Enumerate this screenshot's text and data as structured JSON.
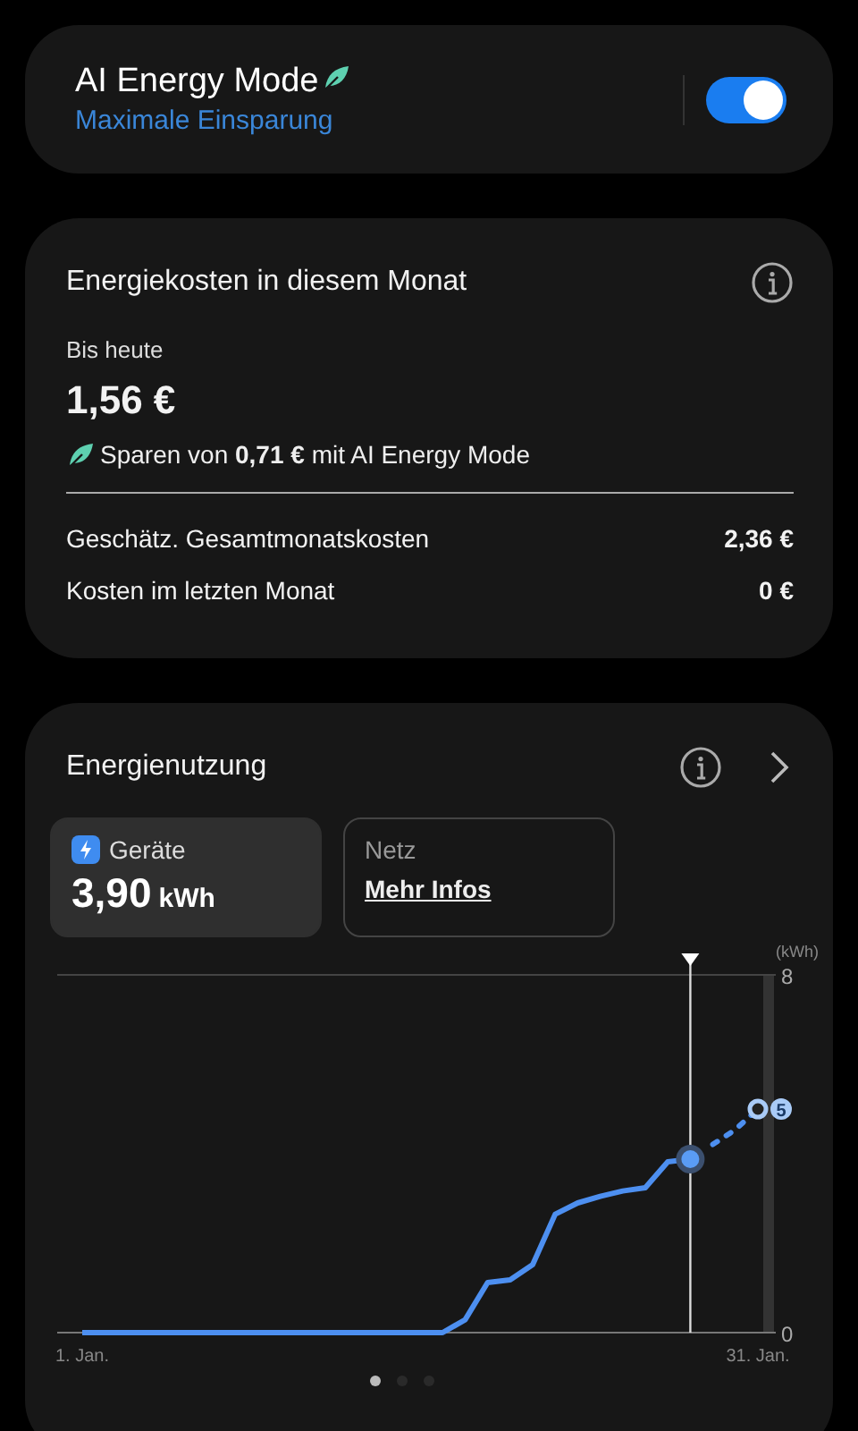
{
  "mode_card": {
    "title": "AI Energy Mode",
    "subtitle": "Maximale Einsparung",
    "on": true
  },
  "cost_card": {
    "title": "Energiekosten in diesem Monat",
    "to_date_label": "Bis heute",
    "to_date_value": "1,56 €",
    "savings": "Sparen von **0,71 €** mit AI Energy Mode",
    "rows": [
      {
        "label": "Geschätz. Gesamtmonatskosten",
        "value": "2,36 €"
      },
      {
        "label": "Kosten im letzten Monat",
        "value": "0 €"
      }
    ]
  },
  "usage_card": {
    "title": "Energienutzung",
    "tiles": [
      {
        "kind": "value",
        "label": "Geräte",
        "value": "3,90",
        "unit": "kWh",
        "selected": true
      },
      {
        "kind": "link",
        "label": "Netz",
        "link": "Mehr Infos",
        "selected": false
      }
    ],
    "chart_data": {
      "type": "line",
      "ylabel": "(kWh)",
      "categories": [
        "1. Jan.",
        null,
        null,
        null,
        null,
        null,
        null,
        null,
        null,
        null,
        null,
        null,
        null,
        null,
        null,
        null,
        null,
        null,
        null,
        null,
        null,
        null,
        null,
        null,
        null,
        null,
        null,
        null,
        null,
        null,
        "31. Jan."
      ],
      "series": [
        {
          "color": "#4d8ff0",
          "line_style": "solid",
          "values": [
            0,
            0,
            0,
            0,
            0,
            0,
            0,
            0,
            0,
            0,
            0,
            0,
            0,
            0,
            0,
            0,
            0,
            0.29,
            1.12,
            1.18,
            1.52,
            2.65,
            2.9,
            3.05,
            3.17,
            3.24,
            3.82,
            3.88,
            null,
            null,
            null
          ]
        },
        {
          "color": "#4d8ff0",
          "line_style": "dashed",
          "values": [
            null,
            null,
            null,
            null,
            null,
            null,
            null,
            null,
            null,
            null,
            null,
            null,
            null,
            null,
            null,
            null,
            null,
            null,
            null,
            null,
            null,
            null,
            null,
            null,
            null,
            null,
            null,
            null,
            4.21,
            4.54,
            5
          ]
        }
      ],
      "ylim": [
        0,
        8
      ],
      "yticks": [
        0,
        8
      ],
      "annotations": [
        {
          "x": "31. Jan.",
          "y": 5,
          "text": "5"
        }
      ]
    },
    "pager": [
      {
        "selected": true
      },
      {
        "selected": false
      },
      {
        "selected": false
      }
    ]
  }
}
